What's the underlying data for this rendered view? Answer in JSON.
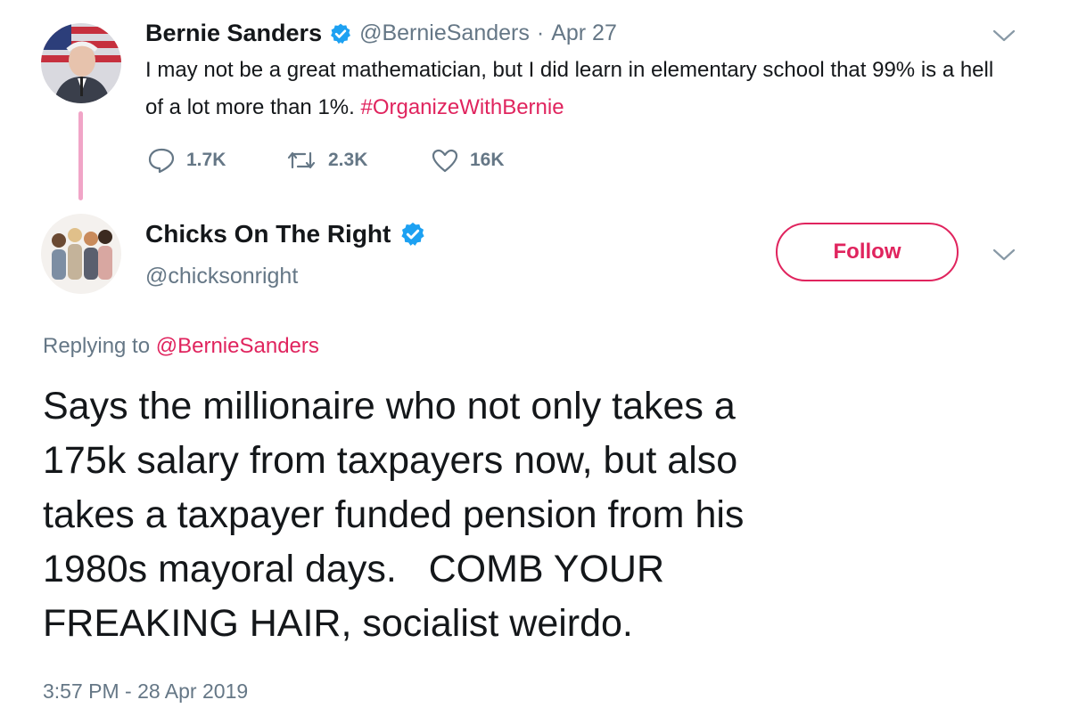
{
  "quoted_tweet": {
    "author_name": "Bernie Sanders",
    "author_handle": "@BernieSanders",
    "separator": "·",
    "date": "Apr 27",
    "text": "I may not be a great mathematician, but I did learn in elementary school that 99% is a hell of a lot more than 1%. ",
    "hashtag": "#OrganizeWithBernie",
    "reply_count": "1.7K",
    "retweet_count": "2.3K",
    "like_count": "16K"
  },
  "main_tweet": {
    "author_name": "Chicks On The Right",
    "author_handle": "@chicksonright",
    "follow_label": "Follow",
    "replying_prefix": "Replying to",
    "replying_to": "@BernieSanders",
    "text": "Says the millionaire who not only takes a\n175k salary from taxpayers now, but also\ntakes a taxpayer funded pension from his\n1980s mayoral days.   COMB YOUR\nFREAKING HAIR, socialist weirdo.",
    "timestamp": "3:57 PM - 28 Apr 2019"
  },
  "icons": {
    "verified": "verified-badge-icon",
    "reply": "reply-icon",
    "retweet": "retweet-icon",
    "like": "heart-icon",
    "menu": "chevron-down-icon"
  },
  "colors": {
    "accent": "#e0245e",
    "verified": "#1da1f2",
    "thread_line": "#f1a5c7",
    "muted": "#657786"
  }
}
